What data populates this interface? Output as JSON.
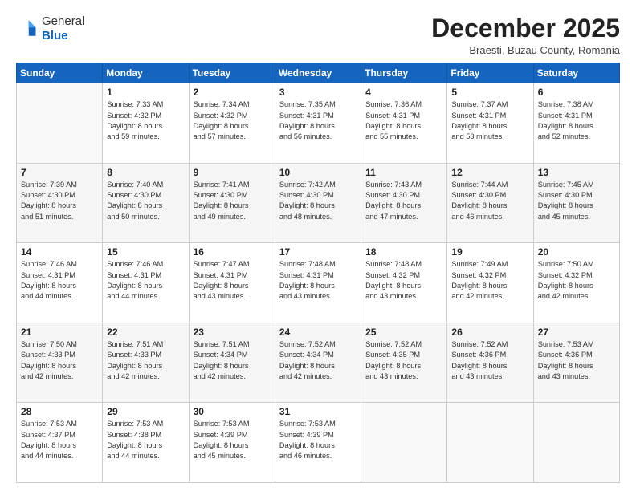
{
  "header": {
    "logo_general": "General",
    "logo_blue": "Blue",
    "month_year": "December 2025",
    "location": "Braesti, Buzau County, Romania"
  },
  "days_of_week": [
    "Sunday",
    "Monday",
    "Tuesday",
    "Wednesday",
    "Thursday",
    "Friday",
    "Saturday"
  ],
  "weeks": [
    [
      {
        "day": "",
        "info": ""
      },
      {
        "day": "1",
        "info": "Sunrise: 7:33 AM\nSunset: 4:32 PM\nDaylight: 8 hours\nand 59 minutes."
      },
      {
        "day": "2",
        "info": "Sunrise: 7:34 AM\nSunset: 4:32 PM\nDaylight: 8 hours\nand 57 minutes."
      },
      {
        "day": "3",
        "info": "Sunrise: 7:35 AM\nSunset: 4:31 PM\nDaylight: 8 hours\nand 56 minutes."
      },
      {
        "day": "4",
        "info": "Sunrise: 7:36 AM\nSunset: 4:31 PM\nDaylight: 8 hours\nand 55 minutes."
      },
      {
        "day": "5",
        "info": "Sunrise: 7:37 AM\nSunset: 4:31 PM\nDaylight: 8 hours\nand 53 minutes."
      },
      {
        "day": "6",
        "info": "Sunrise: 7:38 AM\nSunset: 4:31 PM\nDaylight: 8 hours\nand 52 minutes."
      }
    ],
    [
      {
        "day": "7",
        "info": "Sunrise: 7:39 AM\nSunset: 4:30 PM\nDaylight: 8 hours\nand 51 minutes."
      },
      {
        "day": "8",
        "info": "Sunrise: 7:40 AM\nSunset: 4:30 PM\nDaylight: 8 hours\nand 50 minutes."
      },
      {
        "day": "9",
        "info": "Sunrise: 7:41 AM\nSunset: 4:30 PM\nDaylight: 8 hours\nand 49 minutes."
      },
      {
        "day": "10",
        "info": "Sunrise: 7:42 AM\nSunset: 4:30 PM\nDaylight: 8 hours\nand 48 minutes."
      },
      {
        "day": "11",
        "info": "Sunrise: 7:43 AM\nSunset: 4:30 PM\nDaylight: 8 hours\nand 47 minutes."
      },
      {
        "day": "12",
        "info": "Sunrise: 7:44 AM\nSunset: 4:30 PM\nDaylight: 8 hours\nand 46 minutes."
      },
      {
        "day": "13",
        "info": "Sunrise: 7:45 AM\nSunset: 4:30 PM\nDaylight: 8 hours\nand 45 minutes."
      }
    ],
    [
      {
        "day": "14",
        "info": "Sunrise: 7:46 AM\nSunset: 4:31 PM\nDaylight: 8 hours\nand 44 minutes."
      },
      {
        "day": "15",
        "info": "Sunrise: 7:46 AM\nSunset: 4:31 PM\nDaylight: 8 hours\nand 44 minutes."
      },
      {
        "day": "16",
        "info": "Sunrise: 7:47 AM\nSunset: 4:31 PM\nDaylight: 8 hours\nand 43 minutes."
      },
      {
        "day": "17",
        "info": "Sunrise: 7:48 AM\nSunset: 4:31 PM\nDaylight: 8 hours\nand 43 minutes."
      },
      {
        "day": "18",
        "info": "Sunrise: 7:48 AM\nSunset: 4:32 PM\nDaylight: 8 hours\nand 43 minutes."
      },
      {
        "day": "19",
        "info": "Sunrise: 7:49 AM\nSunset: 4:32 PM\nDaylight: 8 hours\nand 42 minutes."
      },
      {
        "day": "20",
        "info": "Sunrise: 7:50 AM\nSunset: 4:32 PM\nDaylight: 8 hours\nand 42 minutes."
      }
    ],
    [
      {
        "day": "21",
        "info": "Sunrise: 7:50 AM\nSunset: 4:33 PM\nDaylight: 8 hours\nand 42 minutes."
      },
      {
        "day": "22",
        "info": "Sunrise: 7:51 AM\nSunset: 4:33 PM\nDaylight: 8 hours\nand 42 minutes."
      },
      {
        "day": "23",
        "info": "Sunrise: 7:51 AM\nSunset: 4:34 PM\nDaylight: 8 hours\nand 42 minutes."
      },
      {
        "day": "24",
        "info": "Sunrise: 7:52 AM\nSunset: 4:34 PM\nDaylight: 8 hours\nand 42 minutes."
      },
      {
        "day": "25",
        "info": "Sunrise: 7:52 AM\nSunset: 4:35 PM\nDaylight: 8 hours\nand 43 minutes."
      },
      {
        "day": "26",
        "info": "Sunrise: 7:52 AM\nSunset: 4:36 PM\nDaylight: 8 hours\nand 43 minutes."
      },
      {
        "day": "27",
        "info": "Sunrise: 7:53 AM\nSunset: 4:36 PM\nDaylight: 8 hours\nand 43 minutes."
      }
    ],
    [
      {
        "day": "28",
        "info": "Sunrise: 7:53 AM\nSunset: 4:37 PM\nDaylight: 8 hours\nand 44 minutes."
      },
      {
        "day": "29",
        "info": "Sunrise: 7:53 AM\nSunset: 4:38 PM\nDaylight: 8 hours\nand 44 minutes."
      },
      {
        "day": "30",
        "info": "Sunrise: 7:53 AM\nSunset: 4:39 PM\nDaylight: 8 hours\nand 45 minutes."
      },
      {
        "day": "31",
        "info": "Sunrise: 7:53 AM\nSunset: 4:39 PM\nDaylight: 8 hours\nand 46 minutes."
      },
      {
        "day": "",
        "info": ""
      },
      {
        "day": "",
        "info": ""
      },
      {
        "day": "",
        "info": ""
      }
    ]
  ]
}
